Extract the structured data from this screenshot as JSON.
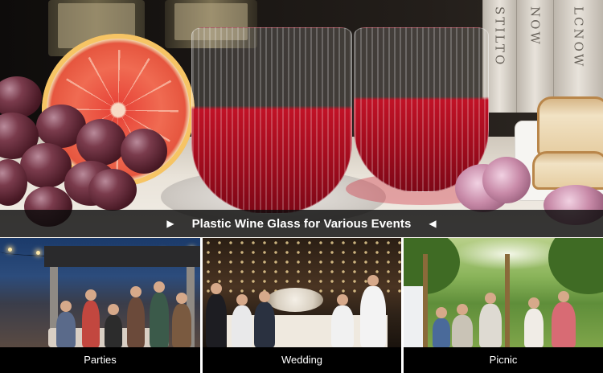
{
  "banner": {
    "title": "Plastic Wine Glass for Various Events",
    "left_marker": "▶",
    "right_marker": "◀"
  },
  "hero": {
    "book_spines": [
      "STILTO",
      "NOW",
      "LCNOW"
    ]
  },
  "panels": [
    {
      "caption": "Parties"
    },
    {
      "caption": "Wedding"
    },
    {
      "caption": "Picnic"
    }
  ],
  "colors": {
    "wine": "#b00f22",
    "banner_bg": "#0c0c0c",
    "caption_bg": "#000000",
    "text": "#ffffff"
  }
}
